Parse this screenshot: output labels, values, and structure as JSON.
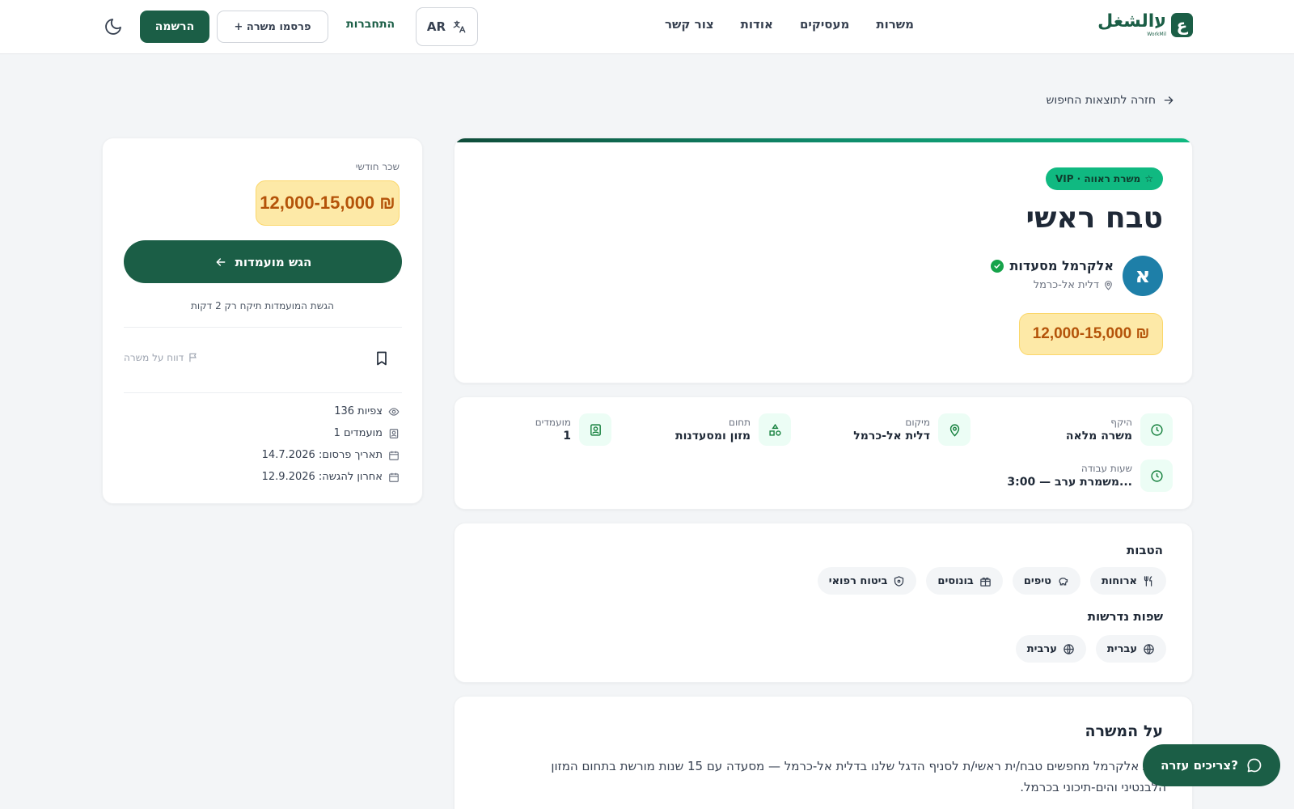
{
  "header": {
    "logo_text": "עالشغل",
    "logo_mark": "ع",
    "logo_sub": "WorkMil",
    "nav": [
      "משרות",
      "מעסיקים",
      "אודות",
      "צור קשר"
    ],
    "lang_label": "AR",
    "login_label": "התחברות",
    "post_job_label": "+ פרסמו משרה",
    "signup_label": "הרשמה"
  },
  "back_link": "חזרה לתוצאות החיפוש",
  "job": {
    "vip_badge": "VIP · משרת ראווה",
    "title": "טבח ראשי",
    "company_initial": "א",
    "company_name": "אלקרמל מסעדות",
    "location": "דלית אל-כרמל",
    "salary": "12,000-15,000 ₪"
  },
  "details": [
    {
      "label": "היקף",
      "value": "משרה מלאה",
      "icon": "clock-icon"
    },
    {
      "label": "מיקום",
      "value": "דלית אל-כרמל",
      "icon": "map-pin-icon"
    },
    {
      "label": "תחום",
      "value": "מזון ומסעדנות",
      "icon": "category-icon"
    },
    {
      "label": "מועמדים",
      "value": "1",
      "icon": "applicants-icon"
    },
    {
      "label": "שעות עבודה",
      "value": "משמרת ערב — 3:00...",
      "icon": "clock-icon"
    }
  ],
  "benefits_title": "הטבות",
  "benefits": [
    {
      "label": "ארוחות",
      "icon": "utensils-icon"
    },
    {
      "label": "טיפים",
      "icon": "piggy-bank-icon"
    },
    {
      "label": "בונוסים",
      "icon": "gift-icon"
    },
    {
      "label": "ביטוח רפואי",
      "icon": "shield-icon"
    }
  ],
  "languages_title": "שפות נדרשות",
  "languages": [
    {
      "label": "עברית",
      "icon": "globe-icon"
    },
    {
      "label": "ערבית",
      "icon": "globe-icon"
    }
  ],
  "about": {
    "title": "על המשרה",
    "text": "רשת אלקרמל מחפשים טבח/ית ראשי/ת לסניף הדגל שלנו בדלית אל-כרמל — מסעדה עם 15 שנות מורשת בתחום המזון הלבנטיני והים-תיכוני בכרמל."
  },
  "sidebar": {
    "salary_label": "שכר חודשי",
    "salary": "12,000-15,000 ₪",
    "apply_label": "הגש מועמדות",
    "apply_note": "הגשת המועמדות תיקח רק 2 דקות",
    "report_label": "דווח על משרה",
    "views": "136 צפיות",
    "applicants": "1 מועמדים",
    "published": "תאריך פרסום: 14.7.2026",
    "deadline": "אחרון להגשה: 12.9.2026"
  },
  "help_label": "צריכים עזרה?",
  "colors": {
    "brand": "#1b5e46",
    "vip": "#10b981",
    "salary_bg": "#fde9a7",
    "salary_text": "#b45309",
    "avatar": "#1e7fa8"
  }
}
